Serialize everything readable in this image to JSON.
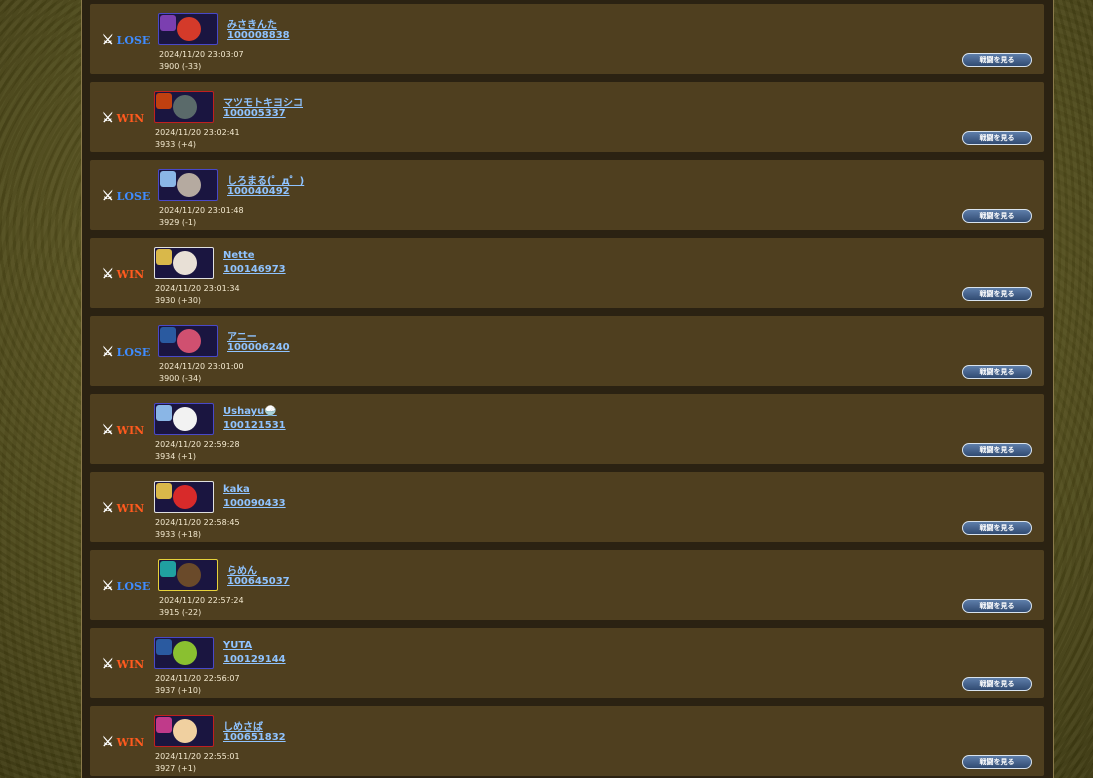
{
  "colors": {
    "win": "#ff5a1e",
    "lose": "#3f8cff",
    "link": "#8fc3ff",
    "row_background": "#4f3f1f",
    "button_fill": "#4a6a96"
  },
  "icons": {
    "result_icon": "crossed-swords-icon"
  },
  "watch_button_label": "戦闘を見る",
  "battles": [
    {
      "result": "LOSE",
      "name": "みさきんた",
      "id": "100008838",
      "datetime": "2024/11/20 23:03:07",
      "rating": "3900 (-33)",
      "frame": "blue",
      "sub_color": "#7b3fb0",
      "face_color": "#d43a2a"
    },
    {
      "result": "WIN",
      "name": "マツモトキヨシコ",
      "id": "100005337",
      "datetime": "2024/11/20 23:02:41",
      "rating": "3933 (+4)",
      "frame": "red",
      "sub_color": "#c04010",
      "face_color": "#5a6a6a"
    },
    {
      "result": "LOSE",
      "name": "しろまる(゜д゜)",
      "id": "100040492",
      "datetime": "2024/11/20 23:01:48",
      "rating": "3929 (-1)",
      "frame": "blue",
      "sub_color": "#8ab6e6",
      "face_color": "#b5aaa0"
    },
    {
      "result": "WIN",
      "name": "Nette",
      "id": "100146973",
      "datetime": "2024/11/20 23:01:34",
      "rating": "3930 (+30)",
      "frame": "white",
      "sub_color": "#d9b84a",
      "face_color": "#e8e0d6"
    },
    {
      "result": "LOSE",
      "name": "アニー",
      "id": "100006240",
      "datetime": "2024/11/20 23:01:00",
      "rating": "3900 (-34)",
      "frame": "blue",
      "sub_color": "#2a5aa0",
      "face_color": "#d05070"
    },
    {
      "result": "WIN",
      "name": "Ushayu🍚",
      "id": "100121531",
      "datetime": "2024/11/20 22:59:28",
      "rating": "3934 (+1)",
      "frame": "blue",
      "sub_color": "#8ab6e6",
      "face_color": "#f2f2f2"
    },
    {
      "result": "WIN",
      "name": "kaka",
      "id": "100090433",
      "datetime": "2024/11/20 22:58:45",
      "rating": "3933 (+18)",
      "frame": "white",
      "sub_color": "#d9b84a",
      "face_color": "#d82a2a"
    },
    {
      "result": "LOSE",
      "name": "らめん",
      "id": "100645037",
      "datetime": "2024/11/20 22:57:24",
      "rating": "3915 (-22)",
      "frame": "yellow",
      "sub_color": "#20a0a0",
      "face_color": "#6a4a2a"
    },
    {
      "result": "WIN",
      "name": "YUTA",
      "id": "100129144",
      "datetime": "2024/11/20 22:56:07",
      "rating": "3937 (+10)",
      "frame": "blue",
      "sub_color": "#2a5aa0",
      "face_color": "#8ac030"
    },
    {
      "result": "WIN",
      "name": "しめさば",
      "id": "100651832",
      "datetime": "2024/11/20 22:55:01",
      "rating": "3927 (+1)",
      "frame": "red",
      "sub_color": "#c03a8a",
      "face_color": "#f0d0a0"
    }
  ]
}
